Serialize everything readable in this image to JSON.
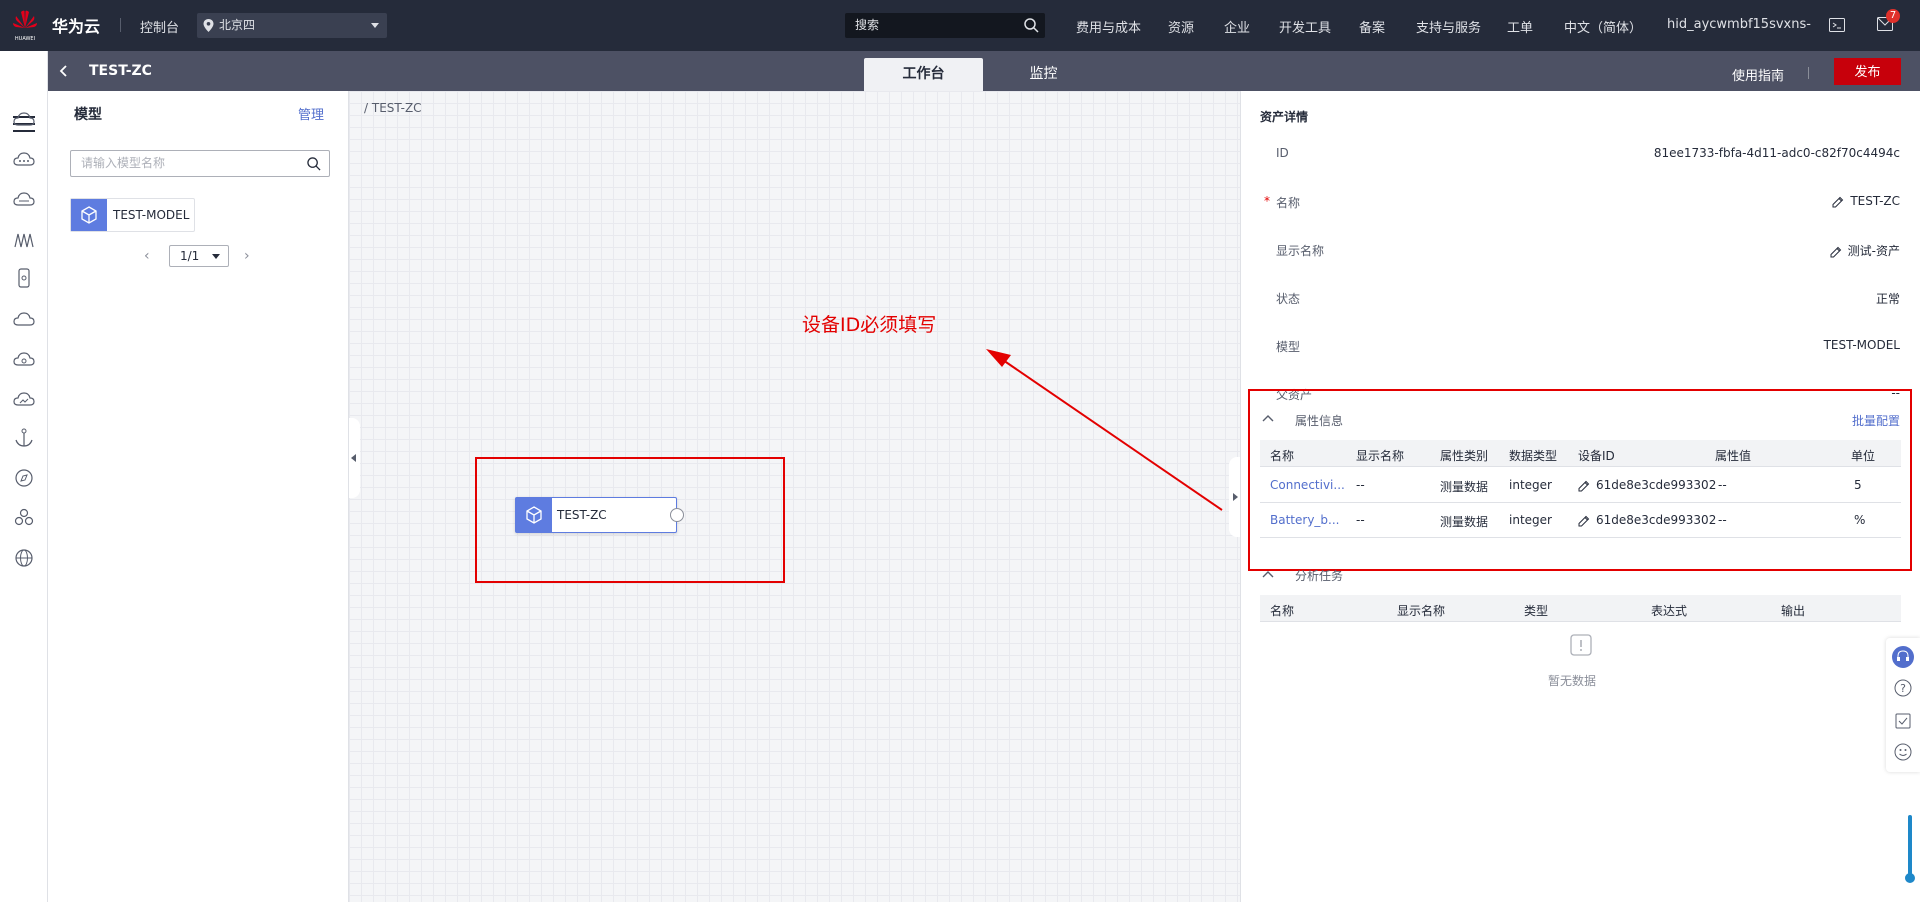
{
  "topbar": {
    "brand": "华为云",
    "logo_text": "HUAWEI",
    "console": "控制台",
    "region": "北京四",
    "search_placeholder": "搜索",
    "nav": [
      "费用与成本",
      "资源",
      "企业",
      "开发工具",
      "备案",
      "支持与服务",
      "工单",
      "中文（简体）"
    ],
    "user": "hid_aycwmbf15svxns-",
    "mail_badge": "7"
  },
  "subbar": {
    "title": "TEST-ZC",
    "tabs": [
      "工作台",
      "监控"
    ],
    "guide": "使用指南",
    "publish": "发布"
  },
  "left_nav": {
    "icons": [
      "menu-icon",
      "cloud-icon",
      "cloud-network-icon",
      "cloud-compute-icon",
      "bridge-icon",
      "device-icon",
      "cloud-storage-icon",
      "cloud-db-icon",
      "cloud-analytics-icon",
      "anchor-icon",
      "compass-icon",
      "cluster-icon",
      "globe-icon"
    ]
  },
  "models": {
    "title": "模型",
    "manage": "管理",
    "search_placeholder": "请输入模型名称",
    "items": [
      "TEST-MODEL"
    ],
    "page": "1/1"
  },
  "canvas": {
    "breadcrumb": "/ TEST-ZC",
    "node_label": "TEST-ZC",
    "annotation": "设备ID必须填写"
  },
  "detail": {
    "title": "资产详情",
    "fields": [
      {
        "label": "ID",
        "value": "81ee1733-fbfa-4d11-adc0-c82f70c4494c"
      },
      {
        "label": "名称",
        "value": "TEST-ZC",
        "required": true,
        "editable": true
      },
      {
        "label": "显示名称",
        "value": "测试-资产",
        "editable": true
      },
      {
        "label": "状态",
        "value": "正常"
      },
      {
        "label": "模型",
        "value": "TEST-MODEL"
      },
      {
        "label": "父资产",
        "value": "--"
      }
    ],
    "attributes": {
      "title": "属性信息",
      "batch": "批量配置",
      "columns": [
        "名称",
        "显示名称",
        "属性类别",
        "数据类型",
        "设备ID",
        "属性值",
        "单位"
      ],
      "rows": [
        [
          "Connectivi...",
          "--",
          "测量数据",
          "integer",
          "61de8e3cde993302",
          "--",
          "5"
        ],
        [
          "Battery_b...",
          "--",
          "测量数据",
          "integer",
          "61de8e3cde993302",
          "--",
          "%"
        ]
      ]
    },
    "analysis": {
      "title": "分析任务",
      "columns": [
        "名称",
        "显示名称",
        "类型",
        "表达式",
        "输出"
      ],
      "empty": "暂无数据"
    }
  },
  "colors": {
    "accent": "#526ecc",
    "brand_red": "#c7000b",
    "annotation": "#e30000",
    "topbar": "#252b3a"
  }
}
